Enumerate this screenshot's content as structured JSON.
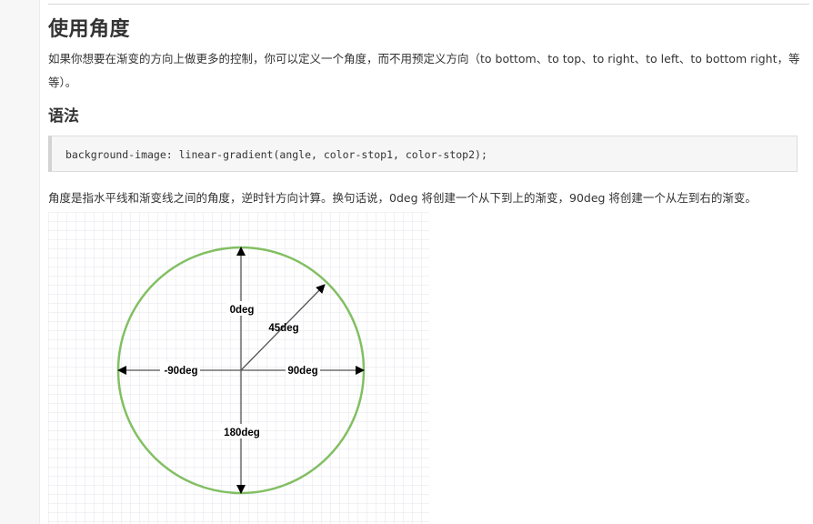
{
  "page": {
    "title": "使用角度",
    "intro": "如果你想要在渐变的方向上做更多的控制，你可以定义一个角度，而不用预定义方向（to bottom、to top、to right、to left、to bottom right，等等）。",
    "syntax_heading": "语法",
    "code": "background-image: linear-gradient(angle, color-stop1, color-stop2);",
    "description": "角度是指水平线和渐变线之间的角度，逆时针方向计算。换句话说，0deg 将创建一个从下到上的渐变，90deg 将创建一个从左到右的渐变。"
  },
  "diagram": {
    "labels": {
      "top": "0deg",
      "diag": "45deg",
      "left": "-90deg",
      "right": "90deg",
      "bottom": "180deg"
    },
    "colors": {
      "circle": "#82bf63",
      "grid": "#e6e6ec",
      "arrow": "#000000",
      "line": "#555555"
    }
  }
}
